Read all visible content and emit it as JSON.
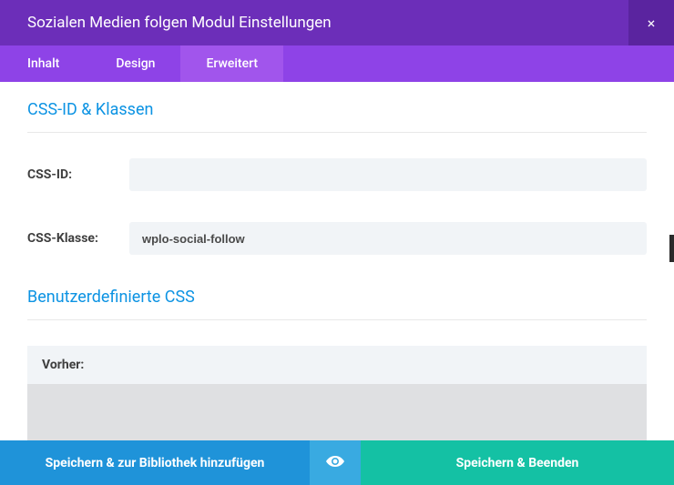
{
  "header": {
    "title": "Sozialen Medien folgen Modul Einstellungen",
    "close_label": "×"
  },
  "tabs": {
    "items": [
      {
        "label": "Inhalt",
        "active": false
      },
      {
        "label": "Design",
        "active": false
      },
      {
        "label": "Erweitert",
        "active": true
      }
    ]
  },
  "sections": {
    "css_id_classes": {
      "title": "CSS-ID & Klassen",
      "fields": {
        "css_id": {
          "label": "CSS-ID:",
          "value": ""
        },
        "css_class": {
          "label": "CSS-Klasse:",
          "value": "wplo-social-follow"
        }
      }
    },
    "custom_css": {
      "title": "Benutzerdefinierte CSS",
      "before_label": "Vorher:"
    }
  },
  "footer": {
    "library_label": "Speichern & zur Bibliothek hinzufügen",
    "save_label": "Speichern & Beenden"
  }
}
